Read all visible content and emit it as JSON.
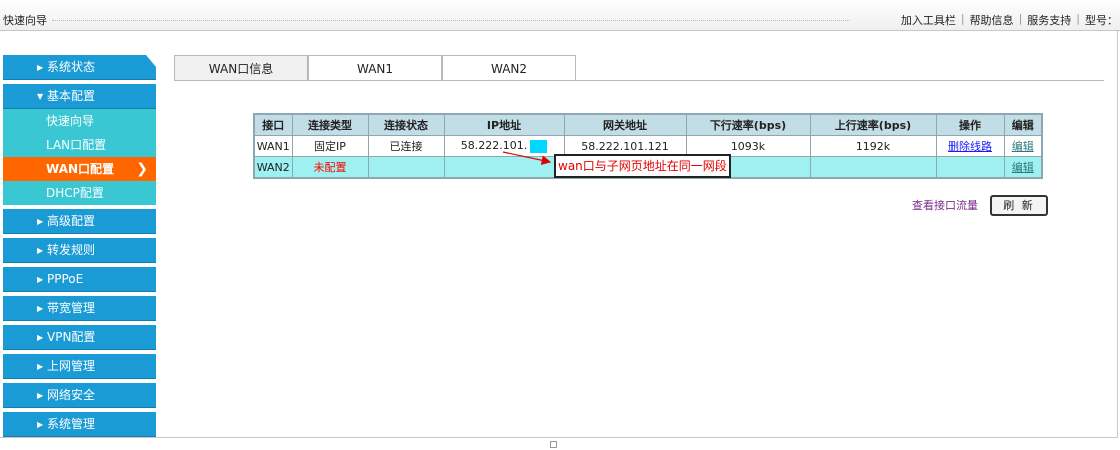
{
  "topbar": {
    "breadcrumb": "快速向导",
    "links": [
      "加入工具栏",
      "帮助信息",
      "服务支持",
      "型号："
    ]
  },
  "sidebar": {
    "items": [
      {
        "label": "系统状态"
      },
      {
        "label": "基本配置",
        "expanded": true,
        "children": [
          "快速向导",
          "LAN口配置",
          "WAN口配置",
          "DHCP配置"
        ],
        "active_child": "WAN口配置"
      },
      {
        "label": "高级配置"
      },
      {
        "label": "转发规则"
      },
      {
        "label": "PPPoE"
      },
      {
        "label": "带宽管理"
      },
      {
        "label": "VPN配置"
      },
      {
        "label": "上网管理"
      },
      {
        "label": "网络安全"
      },
      {
        "label": "系统管理"
      }
    ]
  },
  "tabs": [
    "WAN口信息",
    "WAN1",
    "WAN2"
  ],
  "active_tab": "WAN口信息",
  "table": {
    "headers": [
      "接口",
      "连接类型",
      "连接状态",
      "IP地址",
      "网关地址",
      "下行速率(bps)",
      "上行速率(bps)",
      "操作",
      "编辑"
    ],
    "rows": [
      [
        "WAN1",
        "固定IP",
        "已连接",
        "58.222.101.",
        "58.222.101.121",
        "1093k",
        "1192k",
        "删除线路",
        "编辑"
      ],
      [
        "WAN2",
        "未配置",
        "",
        "",
        "",
        "",
        "",
        "",
        "编辑"
      ]
    ]
  },
  "annotation": "wan口与子网页地址在同一网段",
  "actions": {
    "view_traffic": "查看接口流量",
    "refresh": "刷 新"
  },
  "colors": {
    "sidebar": "#1b9bd6",
    "submenu": "#39c7d4",
    "active": "#ff6600",
    "row2": "#9ff0f0"
  }
}
